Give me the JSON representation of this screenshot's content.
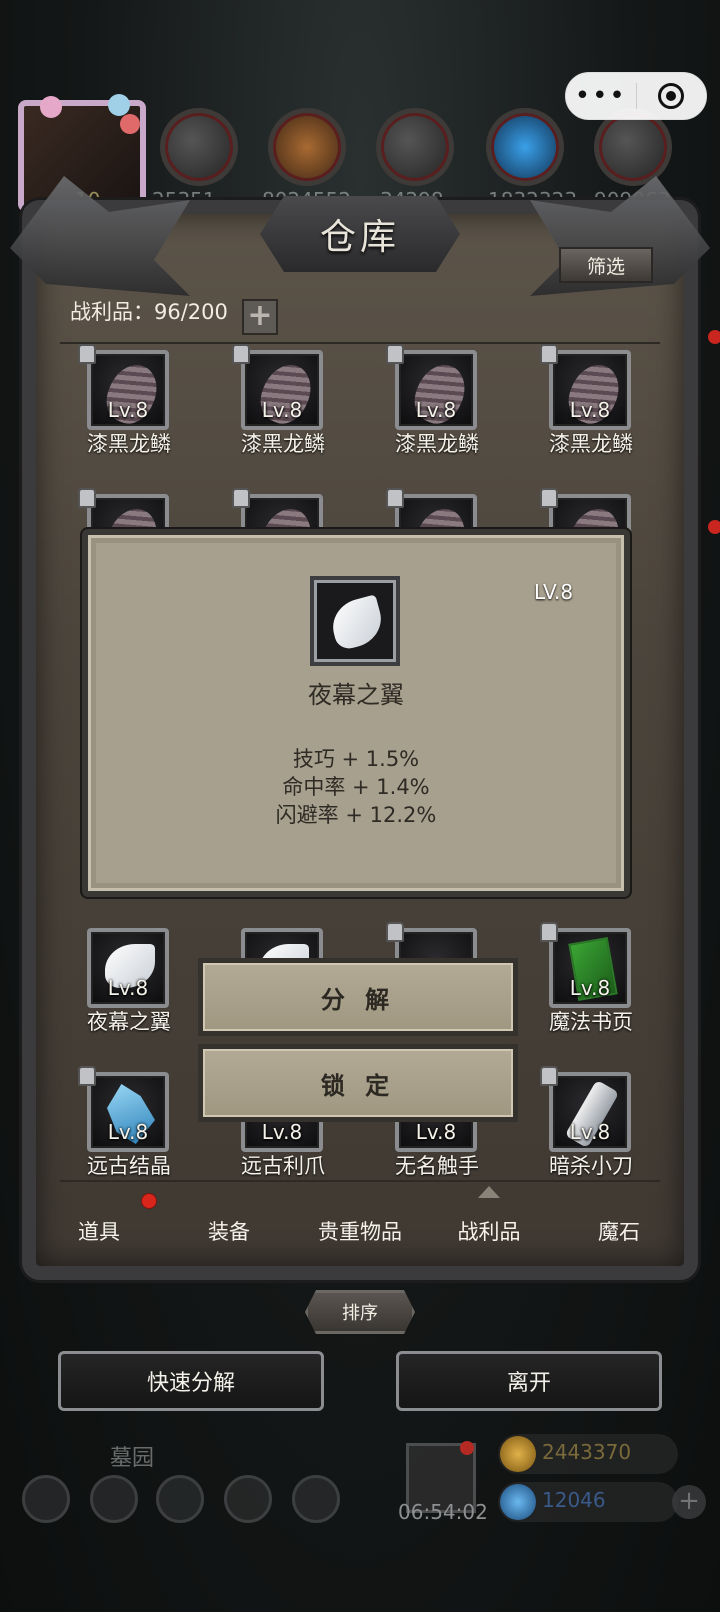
{
  "capsule": {
    "more_icon": "more-dots-icon",
    "close_icon": "target-circle-icon"
  },
  "top_resources": [
    "25351",
    "8024552",
    "34298",
    "1832323",
    "909063"
  ],
  "avatar_level": "10",
  "warehouse": {
    "title": "仓库",
    "filter_label": "筛选",
    "loot_label": "战利品：96/200",
    "plus_label": "+"
  },
  "items": [
    {
      "level": "Lv.8",
      "name": "漆黑龙鳞",
      "icon": "dragon-scale-icon"
    },
    {
      "level": "Lv.8",
      "name": "漆黑龙鳞",
      "icon": "dragon-scale-icon"
    },
    {
      "level": "Lv.8",
      "name": "漆黑龙鳞",
      "icon": "dragon-scale-icon"
    },
    {
      "level": "Lv.8",
      "name": "漆黑龙鳞",
      "icon": "dragon-scale-icon"
    },
    {
      "level": "Lv.8",
      "name": "夜幕之翼",
      "icon": "wing-icon"
    },
    {
      "level": "Lv.8",
      "name": "魔法书页",
      "icon": "magic-page-icon"
    },
    {
      "level": "Lv.8",
      "name": "远古结晶",
      "icon": "crystal-icon"
    },
    {
      "level": "Lv.8",
      "name": "远古利爪",
      "icon": "claw-icon"
    },
    {
      "level": "Lv.8",
      "name": "无名触手",
      "icon": "tentacle-icon"
    },
    {
      "level": "Lv.8",
      "name": "暗杀小刀",
      "icon": "knife-icon"
    }
  ],
  "tooltip": {
    "level": "LV.8",
    "name": "夜幕之翼",
    "stats": [
      "技巧 + 1.5%",
      "命中率 + 1.4%",
      "闪避率 + 12.2%"
    ]
  },
  "actions": {
    "decompose": "分 解",
    "lock": "锁 定"
  },
  "tabs": [
    "道具",
    "装备",
    "贵重物品",
    "战利品",
    "魔石"
  ],
  "sort_label": "排序",
  "bottom_buttons": {
    "quick_decompose": "快速分解",
    "leave": "离开"
  },
  "hud": {
    "location": "墓园",
    "timer": "06:54:02",
    "gold": "2443370",
    "gems": "12046"
  }
}
